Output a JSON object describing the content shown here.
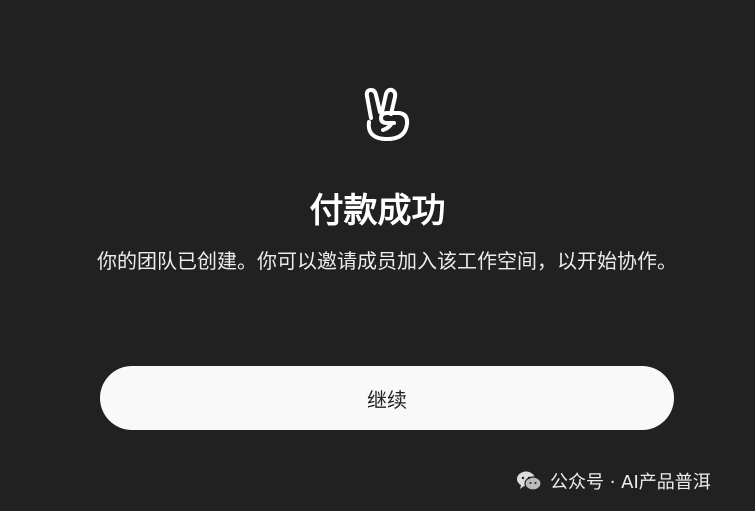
{
  "dialog": {
    "icon": "victory-hand-icon",
    "title": "付款成功",
    "message": "你的团队已创建。你可以邀请成员加入该工作空间，以开始协作。",
    "continue_label": "继续"
  },
  "watermark": {
    "icon": "wechat-icon",
    "text": "公众号 · AI产品普洱"
  },
  "colors": {
    "background": "#212121",
    "button_bg": "#f9f9f9",
    "text": "#ffffff"
  }
}
